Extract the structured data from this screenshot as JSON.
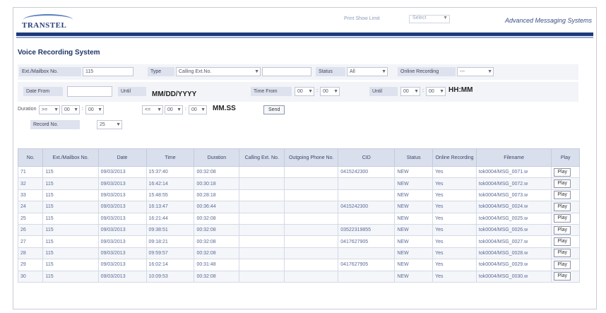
{
  "header": {
    "logo": "TRANSTEL",
    "utility_text": "Print Show Limit",
    "select_value": "Select",
    "app_name": "Advanced Messaging Systems"
  },
  "page": {
    "title": "Voice Recording System"
  },
  "filters": {
    "ext_label": "Ext./Mailbox No.",
    "ext_value": "115",
    "type_label": "Type",
    "type_value": "Calling Ext.No.",
    "type_extra": "",
    "status_label": "Status",
    "status_value": "All",
    "online_label": "Online Recording",
    "online_value": "---",
    "date_from_label": "Date From",
    "date_from_value": "",
    "until_label": "Until",
    "until_value": "",
    "date_format": "MM/DD/YYYY",
    "time_from_label": "Time From",
    "time_from_hh": "00",
    "time_from_mm": "00",
    "until2_label": "Until",
    "until2_hh": "00",
    "until2_mm": "00",
    "time_format": "HH:MM",
    "duration_label": "Duration",
    "duration_op": ">=",
    "duration_mm": "00",
    "duration_ss": "00",
    "duration_op2": "<=",
    "duration_mm2": "00",
    "duration_ss2": "00",
    "duration_format": "MM.SS",
    "send_label": "Send",
    "record_label": "Record No.",
    "record_value": "25"
  },
  "table": {
    "columns": [
      "No.",
      "Ext./Mailbox No.",
      "Date",
      "Time",
      "Duration",
      "Calling Ext. No.",
      "Outgoing Phone No.",
      "CID",
      "Status",
      "Online Recording",
      "Filename",
      "Play"
    ],
    "play_label": "Play",
    "rows": [
      [
        "71",
        "115",
        "09/03/2013",
        "15:37:40",
        "00:32:08",
        "",
        "",
        "0415242300",
        "NEW",
        "Yes",
        "tok0004/MSG_0071.w"
      ],
      [
        "32",
        "115",
        "09/03/2013",
        "16:42:14",
        "00:30:18",
        "",
        "",
        "",
        "NEW",
        "Yes",
        "tok0004/MSG_0072.w"
      ],
      [
        "33",
        "115",
        "09/03/2013",
        "15:48:55",
        "00:28:18",
        "",
        "",
        "",
        "NEW",
        "Yes",
        "tok0004/MSG_0073.w"
      ],
      [
        "24",
        "115",
        "09/03/2013",
        "16:13:47",
        "00:36:44",
        "",
        "",
        "0415242300",
        "NEW",
        "Yes",
        "tok0004/MSG_0024.w"
      ],
      [
        "25",
        "115",
        "09/03/2013",
        "16:21:44",
        "00:32:08",
        "",
        "",
        "",
        "NEW",
        "Yes",
        "tok0004/MSG_0025.w"
      ],
      [
        "26",
        "115",
        "09/03/2013",
        "09:38:51",
        "00:32:08",
        "",
        "",
        "03522319855",
        "NEW",
        "Yes",
        "tok0004/MSG_0026.w"
      ],
      [
        "27",
        "115",
        "09/03/2013",
        "09:18:21",
        "00:32:08",
        "",
        "",
        "0417627905",
        "NEW",
        "Yes",
        "tok0004/MSG_0027.w"
      ],
      [
        "28",
        "115",
        "09/03/2013",
        "09:59:57",
        "00:32:08",
        "",
        "",
        "",
        "NEW",
        "Yes",
        "tok0004/MSG_0028.w"
      ],
      [
        "29",
        "115",
        "09/03/2013",
        "16:02:14",
        "00:31:48",
        "",
        "",
        "0417627905",
        "NEW",
        "Yes",
        "tok0004/MSG_0029.w"
      ],
      [
        "30",
        "115",
        "09/03/2013",
        "10:09:53",
        "00:32:08",
        "",
        "",
        "",
        "NEW",
        "Yes",
        "tok0004/MSG_0030.w"
      ]
    ]
  }
}
